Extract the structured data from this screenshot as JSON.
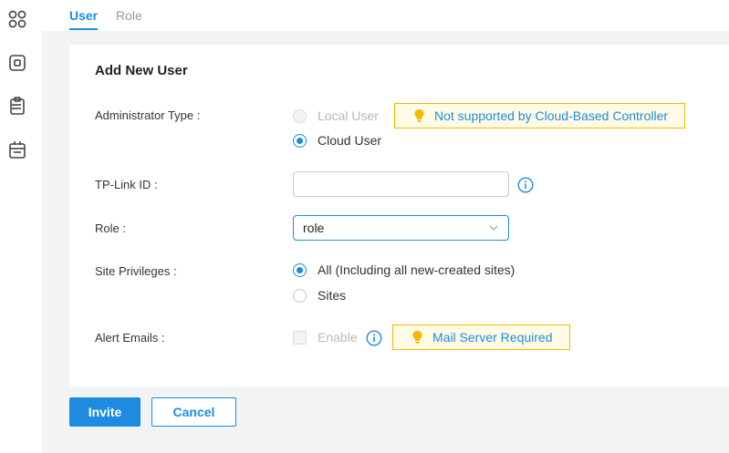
{
  "tabs": [
    {
      "label": "User",
      "active": true
    },
    {
      "label": "Role",
      "active": false
    }
  ],
  "rail": {
    "icons": [
      "dashboard-grid-icon",
      "device-icon",
      "clipboard-icon",
      "calendar-icon"
    ]
  },
  "form": {
    "title": "Add New User",
    "admin_type": {
      "label": "Administrator Type :",
      "options": [
        {
          "label": "Local User",
          "checked": false,
          "disabled": true
        },
        {
          "label": "Cloud User",
          "checked": true,
          "disabled": false
        }
      ],
      "notice": "Not supported by Cloud-Based Controller"
    },
    "tplink_id": {
      "label": "TP-Link ID :",
      "value": "",
      "placeholder": ""
    },
    "role": {
      "label": "Role :",
      "value": "role"
    },
    "site_privileges": {
      "label": "Site Privileges :",
      "options": [
        {
          "label": "All (Including all new-created sites)",
          "checked": true
        },
        {
          "label": "Sites",
          "checked": false
        }
      ]
    },
    "alert_emails": {
      "label": "Alert Emails :",
      "checkbox_label": "Enable",
      "checked": false,
      "notice": "Mail Server Required"
    }
  },
  "actions": {
    "invite_label": "Invite",
    "cancel_label": "Cancel"
  },
  "colors": {
    "accent": "#1d8ce0",
    "notice_border": "#f5b800",
    "notice_bg": "#fffbe6",
    "bulb": "#f5b800"
  }
}
